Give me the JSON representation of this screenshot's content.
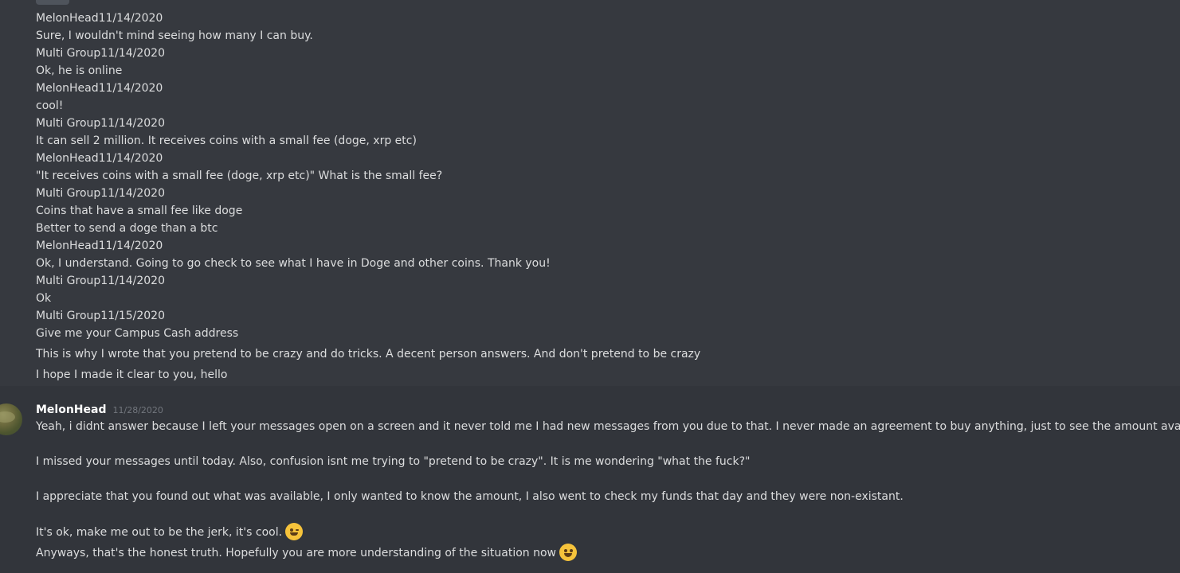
{
  "history": [
    {
      "text": "MelonHead11/14/2020"
    },
    {
      "text": "Sure, I wouldn't mind seeing how many I can buy."
    },
    {
      "text": "Multi Group11/14/2020"
    },
    {
      "text": "Ok, he is online"
    },
    {
      "text": "MelonHead11/14/2020"
    },
    {
      "text": "cool!"
    },
    {
      "text": "Multi Group11/14/2020"
    },
    {
      "text": "It can sell 2 million. It receives coins with a small fee (doge, xrp etc)"
    },
    {
      "text": "MelonHead11/14/2020"
    },
    {
      "text": "\"It receives coins with a small fee (doge, xrp etc)\"  What is the small fee?"
    },
    {
      "text": "Multi Group11/14/2020"
    },
    {
      "text": "Coins that have a small fee like doge"
    },
    {
      "text": "Better to send a doge than a btc"
    },
    {
      "text": "MelonHead11/14/2020"
    },
    {
      "text": "Ok, I understand. Going to go check to see what I have in Doge and other coins. Thank you!"
    },
    {
      "text": "Multi Group11/14/2020"
    },
    {
      "text": "Ok"
    },
    {
      "text": "Multi Group11/15/2020"
    },
    {
      "text": "Give me your Campus Cash address"
    },
    {
      "text": "This is why I wrote that you pretend to be crazy and do tricks. A decent person answers. And don't pretend to be crazy"
    },
    {
      "text": "I hope I made it clear to you, hello"
    }
  ],
  "message": {
    "username": "MelonHead",
    "timestamp": "11/28/2020",
    "lines": [
      "Yeah, i didnt answer because I left your messages open on a screen and it never told me I had new messages from you due to that. I never made an agreement to buy anything, just to see the amount available.",
      "I missed your messages until today. Also, confusion isnt me trying to \"pretend to be crazy\". It is me wondering \"what the fuck?\"",
      "I appreciate that you found out what was available, I only wanted to know the amount, I also went to check my funds that day and they were non-existant.",
      "It's ok, make me out to be the jerk, it's cool.",
      "Anyways, that's the honest truth. Hopefully you are more understanding of the situation now"
    ],
    "emoji_1": "wink-emoji",
    "emoji_2": "grin-emoji"
  },
  "colors": {
    "background": "#36393f",
    "message_highlight": "#32353b",
    "text": "#dcddde",
    "username": "#ffffff",
    "timestamp": "#72767d"
  }
}
